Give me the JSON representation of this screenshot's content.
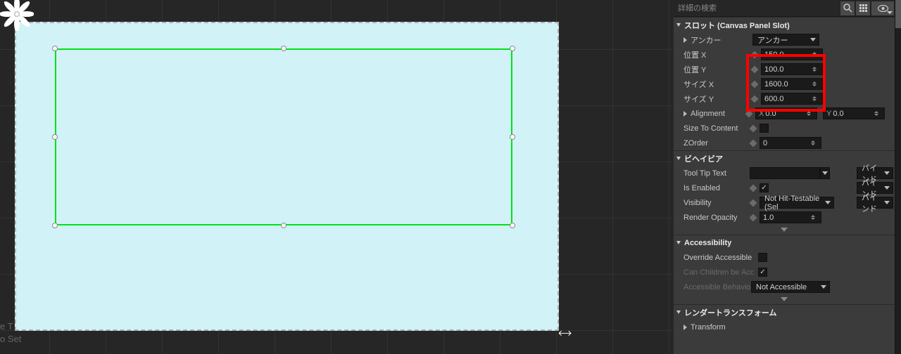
{
  "search": {
    "placeholder": "詳細の検索"
  },
  "cats": {
    "slot": "スロット (Canvas Panel Slot)",
    "behavior": "ビヘイビア",
    "access": "Accessibility",
    "render": "レンダートランスフォーム"
  },
  "slot": {
    "anchors_label": "アンカー",
    "anchors_value": "アンカー",
    "posx_label": "位置 X",
    "posx_value": "150.0",
    "posy_label": "位置 Y",
    "posy_value": "100.0",
    "sizex_label": "サイズ X",
    "sizex_value": "1600.0",
    "sizey_label": "サイズ Y",
    "sizey_value": "600.0",
    "alignment_label": "Alignment",
    "align_x_prefix": "X",
    "align_x_value": "0.0",
    "align_y_prefix": "Y",
    "align_y_value": "0.0",
    "sizetocontent_label": "Size To Content",
    "zorder_label": "ZOrder",
    "zorder_value": "0"
  },
  "beh": {
    "tooltip_label": "Tool Tip Text",
    "isenabled_label": "Is Enabled",
    "visibility_label": "Visibility",
    "visibility_value": "Not Hit-Testable (Sel",
    "opacity_label": "Render Opacity",
    "opacity_value": "1.0",
    "bind": "バインド"
  },
  "acc": {
    "override_label": "Override Accessible",
    "children_label": "Can Children be Acc",
    "behavior_label": "Accessible Behavior",
    "behavior_value": "Not Accessible"
  },
  "render": {
    "transform_label": "Transform"
  },
  "bottom": {
    "l1": "e T",
    "l2": "o Set"
  }
}
